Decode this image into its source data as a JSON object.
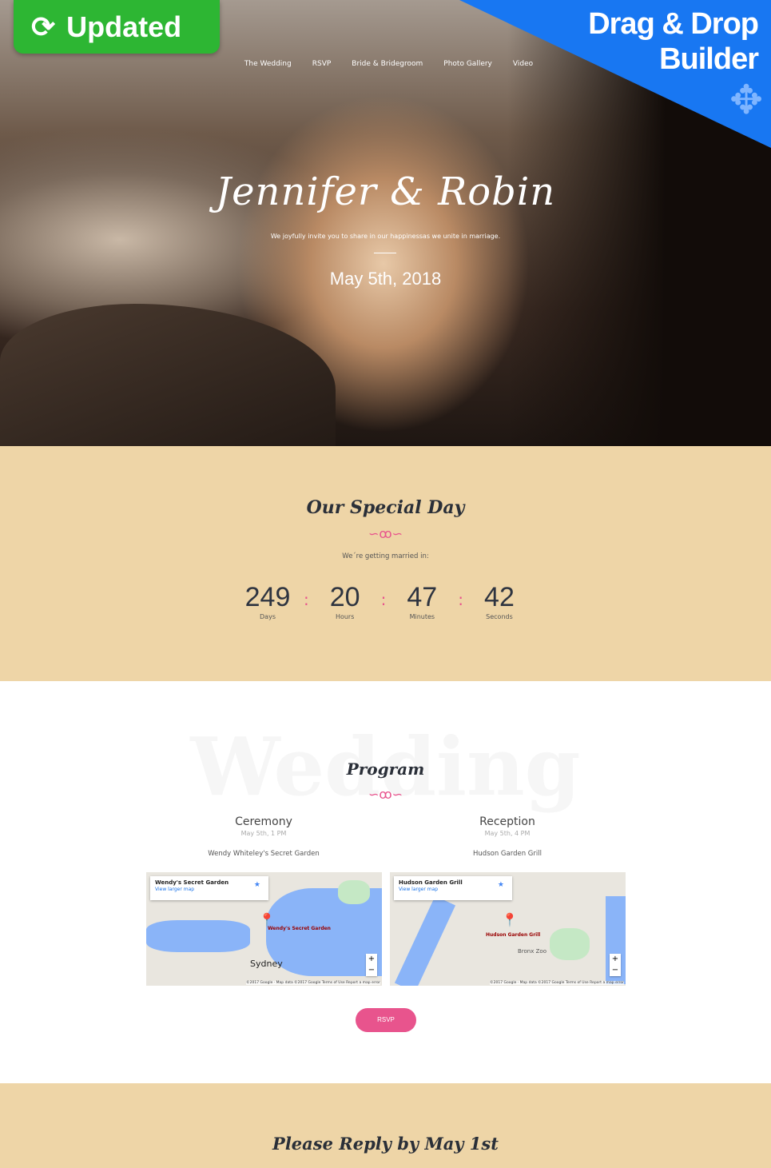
{
  "badge": {
    "label": "Updated",
    "icon": "refresh-icon"
  },
  "promo": {
    "line1": "Drag & Drop",
    "line2": "Builder",
    "icon": "move-arrows-icon"
  },
  "nav": [
    "The Wedding",
    "RSVP",
    "Bride & Bridegroom",
    "Photo Gallery",
    "Video"
  ],
  "hero": {
    "title": "Jennifer & Robin",
    "subtitle": "We joyfully invite you to share in our happinessas we unite in marriage.",
    "date": "May 5th, 2018"
  },
  "special": {
    "title": "Our Special Day",
    "intro": "We´re getting married in:",
    "countdown": [
      {
        "value": "249",
        "label": "Days"
      },
      {
        "value": "20",
        "label": "Hours"
      },
      {
        "value": "47",
        "label": "Minutes"
      },
      {
        "value": "42",
        "label": "Seconds"
      }
    ],
    "separator": ":"
  },
  "program": {
    "watermark": "Wedding",
    "title": "Program",
    "events": [
      {
        "name": "Ceremony",
        "time": "May 5th, 1 PM",
        "venue": "Wendy Whiteley's Secret Garden",
        "map": {
          "place": "Wendy's Secret Garden",
          "link": "View larger map",
          "pin_label": "Wendy's Secret Garden",
          "city": "Sydney",
          "footer": "©2017 Google · Map data ©2017 Google   Terms of Use   Report a map error"
        }
      },
      {
        "name": "Reception",
        "time": "May 5th, 4 PM",
        "venue": "Hudson Garden Grill",
        "map": {
          "place": "Hudson Garden Grill",
          "link": "View larger map",
          "pin_label": "Hudson Garden Grill",
          "city": "Bronx Zoo",
          "footer": "©2017 Google · Map data ©2017 Google   Terms of Use   Report a map error"
        }
      }
    ],
    "rsvp_label": "RSVP"
  },
  "reply": {
    "title": "Please Reply by May 1st"
  },
  "colors": {
    "accent": "#e8548d",
    "beige": "#eed5a7",
    "badge": "#2db633",
    "promo": "#1877f2"
  }
}
